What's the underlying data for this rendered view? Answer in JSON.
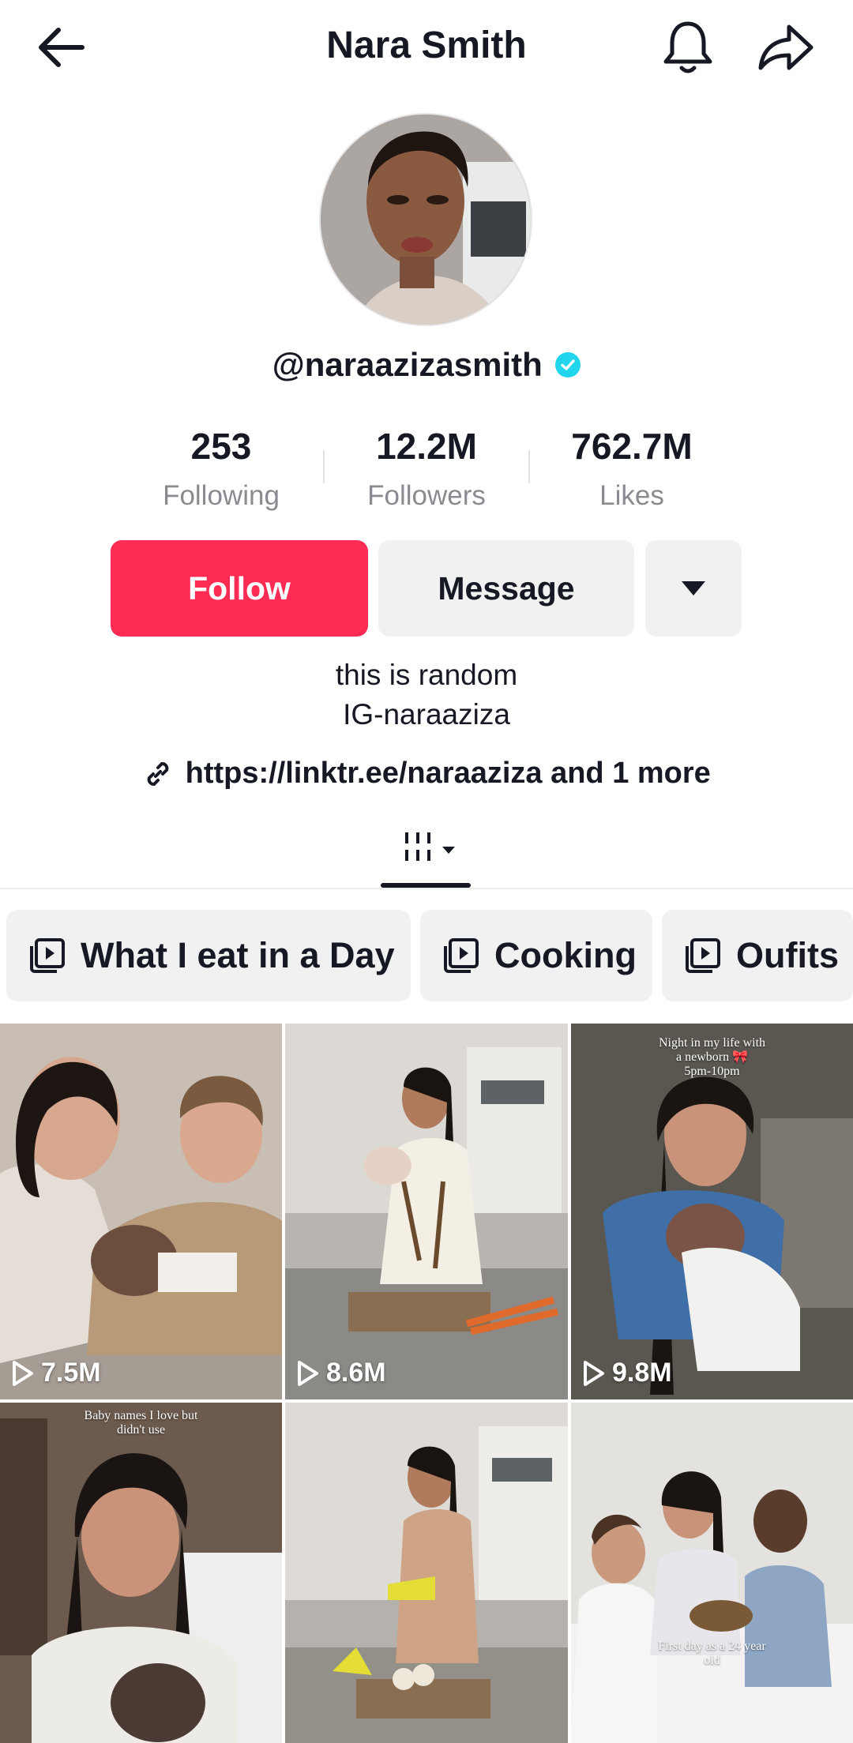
{
  "header": {
    "title": "Nara Smith",
    "back_icon": "arrow-left-icon",
    "bell_icon": "bell-icon",
    "share_icon": "share-arrow-icon"
  },
  "profile": {
    "handle": "@naraazizasmith",
    "verified_color": "#20d5ec",
    "stats": [
      {
        "value": "253",
        "label": "Following"
      },
      {
        "value": "12.2M",
        "label": "Followers"
      },
      {
        "value": "762.7M",
        "label": "Likes"
      }
    ],
    "buttons": {
      "follow": "Follow",
      "message": "Message"
    },
    "bio_line1": "this is random",
    "bio_line2": "IG-naraaziza",
    "link": "https://linktr.ee/naraaziza and 1 more"
  },
  "colors": {
    "accent": "#fe2c55",
    "secondary_bg": "#f1f1f2",
    "muted_text": "#8a8b91"
  },
  "playlists": [
    {
      "label": "What I eat in a Day"
    },
    {
      "label": "Cooking"
    },
    {
      "label": "Oufits"
    }
  ],
  "videos": [
    {
      "views": "7.5M",
      "caption": ""
    },
    {
      "views": "8.6M",
      "caption": ""
    },
    {
      "views": "9.8M",
      "caption_lines": [
        "Night in my life with",
        "a newborn 🎀",
        "5pm-10pm"
      ]
    },
    {
      "views": "",
      "caption_lines": [
        "Baby names I love but",
        "didn't use"
      ]
    },
    {
      "views": "",
      "caption": ""
    },
    {
      "views": "",
      "caption_lines": [
        "First day as a 24 year",
        "old"
      ]
    }
  ]
}
